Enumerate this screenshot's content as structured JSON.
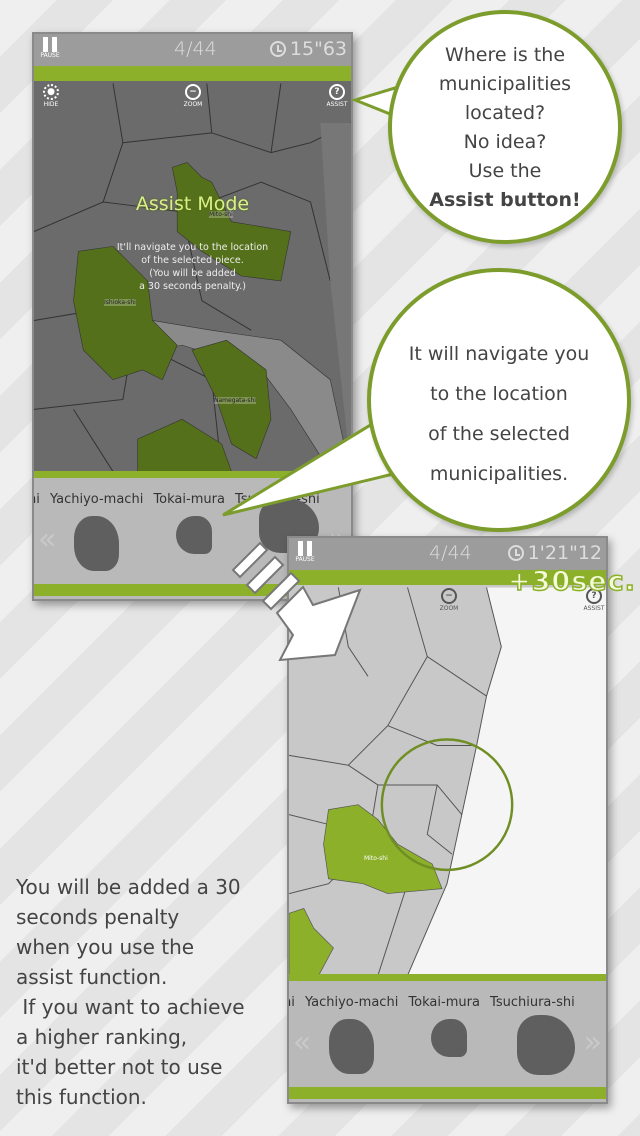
{
  "screen1": {
    "pause_label": "PAUSE",
    "counter": "4/44",
    "timer": "15\"63",
    "tools": {
      "hide": "HIDE",
      "zoom": "ZOOM",
      "assist": "ASSIST"
    },
    "overlay_title": "Assist Mode",
    "overlay_lines": [
      "It'll navigate you to the location",
      "of the selected piece.",
      "(You will be added",
      "a 30 seconds penalty.)"
    ],
    "map_labels": [
      "Mito-shi",
      "Ishioka-shi",
      "Namegata-shi"
    ],
    "pieces": "hi Yachiyo-machi   Tokai-mura   Tsuchiura-shi"
  },
  "screen2": {
    "pause_label": "PAUSE",
    "counter": "4/44",
    "timer": "1'21\"12",
    "tools": {
      "zoom": "ZOOM",
      "assist": "ASSIST"
    },
    "map_labels": [
      "Mito-shi"
    ],
    "pieces": "hi Yachiyo-machi   Tokai-mura   Tsuchiura-shi",
    "penalty": "+30sec."
  },
  "bubble1": {
    "lines": [
      "Where is the",
      "municipalities",
      "located?",
      "No idea?",
      "Use the"
    ],
    "bold": "Assist button!"
  },
  "bubble2": {
    "lines": [
      "It will navigate you",
      "to the location",
      "of the selected",
      "municipalities."
    ]
  },
  "description": "You will be added a 30\nseconds penalty\nwhen you use the\nassist function.\n If you want to achieve\na higher ranking,\nit'd better not to use\nthis function.",
  "colors": {
    "accent": "#8db02b",
    "bubble_border": "#7c9c2c",
    "highlight_dark": "#55701a"
  }
}
